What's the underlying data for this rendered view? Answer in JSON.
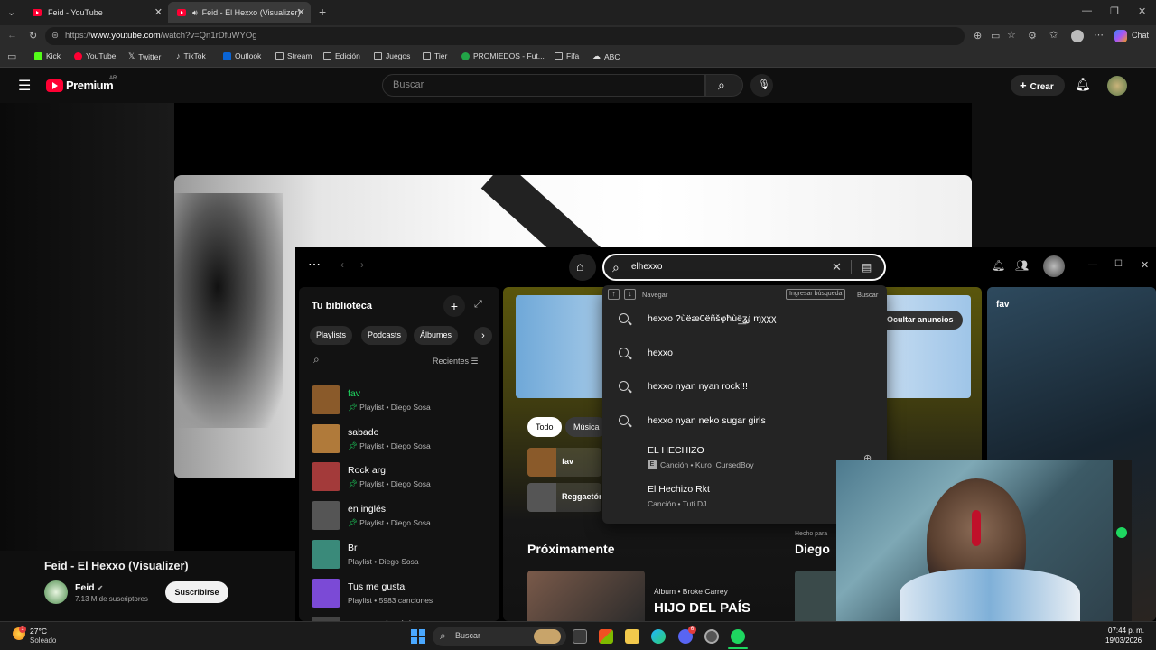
{
  "browser": {
    "tabs": [
      {
        "title": "Feid - YouTube",
        "active": false
      },
      {
        "title": "Feid - El Hexxo (Visualizer) - Y",
        "active": true
      }
    ],
    "url_prefix": "https://",
    "url_host": "www.youtube.com",
    "url_path": "/watch?v=Qn1rDfuWYOg",
    "chat_label": "Chat",
    "bookmarks": [
      "Kick",
      "YouTube",
      "Twitter",
      "TikTok",
      "Outlook",
      "Stream",
      "Edición",
      "Juegos",
      "Tier",
      "PROMIEDOS - Fut...",
      "Fifa",
      "ABC"
    ]
  },
  "youtube": {
    "logo": "Premium",
    "region": "AR",
    "search_placeholder": "Buscar",
    "create_label": "Crear",
    "video_title": "Feid - El Hexxo (Visualizer)",
    "channel": "Feid",
    "subscribers": "7.13 M de suscriptores",
    "subscribe_label": "Suscribirse"
  },
  "spotify": {
    "search_value": "elhexxo",
    "library": {
      "title": "Tu biblioteca",
      "chips": [
        "Playlists",
        "Podcasts",
        "Álbumes"
      ],
      "sort_label": "Recientes",
      "items": [
        {
          "name": "fav",
          "sub": "Playlist • Diego Sosa",
          "pinned": true,
          "color": "#8a5a2a"
        },
        {
          "name": "sabado",
          "sub": "Playlist • Diego Sosa",
          "pinned": true,
          "color": "#b07a3a"
        },
        {
          "name": "Rock arg",
          "sub": "Playlist • Diego Sosa",
          "pinned": true,
          "color": "#a33a3a"
        },
        {
          "name": "en inglés",
          "sub": "Playlist • Diego Sosa",
          "pinned": true,
          "color": "#555555"
        },
        {
          "name": "Br",
          "sub": "Playlist • Diego Sosa",
          "pinned": false,
          "color": "#3a8a7a"
        },
        {
          "name": "Tus me gusta",
          "sub": "Playlist • 5983 canciones",
          "pinned": false,
          "color": "#7b4ad6"
        },
        {
          "name": "Reggaetón viejo",
          "sub": "",
          "pinned": false,
          "color": "#444444"
        }
      ]
    },
    "main": {
      "hide_ads_label": "Ocultar anuncios",
      "filters": [
        "Todo",
        "Música"
      ],
      "mini_cards": [
        "fav",
        "Reggaetón"
      ],
      "upcoming_title": "Próximamente",
      "album_sub": "Álbum • Broke Carrey",
      "album_title": "HIJO DEL PAÍS",
      "made_for": "Hecho para",
      "made_for_name": "Diego"
    },
    "right_panel_title": "fav",
    "dropdown": {
      "navigate_label": "Navegar",
      "enter_label": "Ingresar búsqueda",
      "search_label": "Buscar",
      "suggestions": [
        "hexxo ?ùëæ0ëñšφħùë͟ʓⅉ ɱχχχ",
        "hexxo",
        "hexxo nyan nyan rock!!!",
        "hexxo nyan neko sugar girls"
      ],
      "songs": [
        {
          "title": "EL HECHIZO",
          "sub": "Canción • Kuro_CursedBoy",
          "explicit": true
        },
        {
          "title": "El Hechizo Rkt",
          "sub": "Canción • Tuti DJ",
          "explicit": false
        }
      ]
    }
  },
  "taskbar": {
    "weather_temp": "27°C",
    "weather_desc": "Soleado",
    "search_label": "Buscar",
    "time": "07:44 p. m.",
    "date": "19/03/2026",
    "notification_count": "6"
  },
  "colors": {
    "youtube_red": "#ff0033",
    "spotify_green": "#1ed760"
  }
}
